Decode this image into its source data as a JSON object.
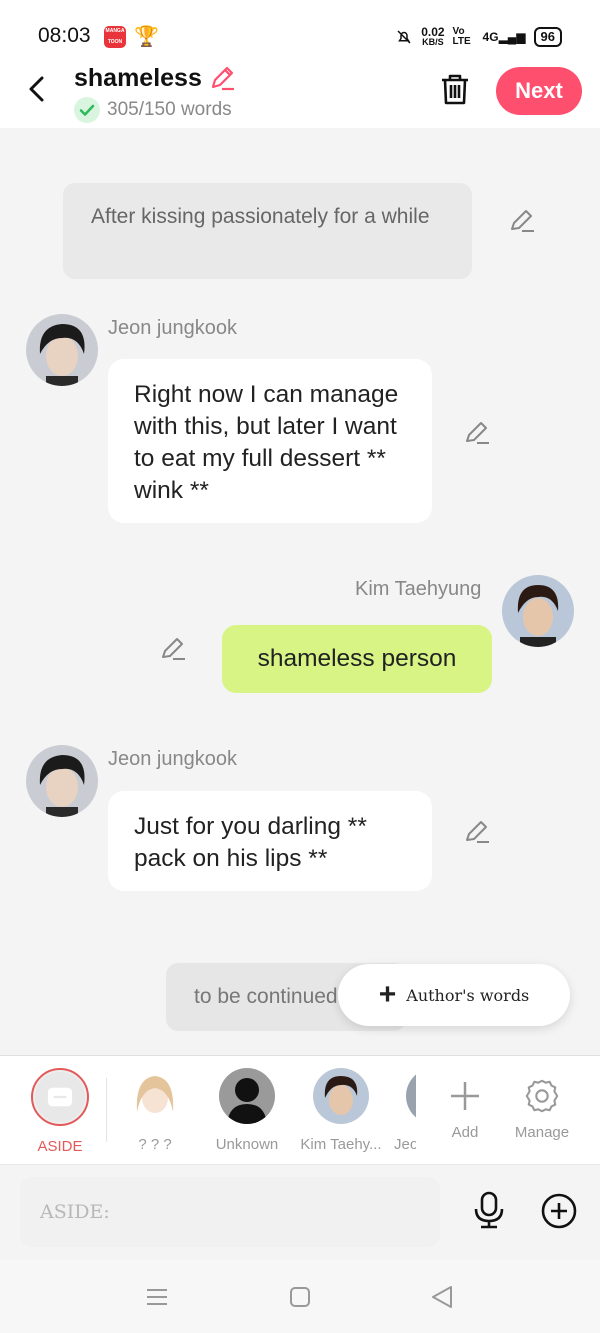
{
  "status_bar": {
    "time": "08:03",
    "app_badge_text": "MANGA TOON",
    "net_speed": "0.02",
    "net_unit": "KB/S",
    "volte": "Vo LTE",
    "signal": "4G",
    "battery": "96"
  },
  "header": {
    "title": "shameless",
    "word_count": "305/150 words",
    "next_label": "Next"
  },
  "messages": {
    "aside_text": "After kissing passionately for a while",
    "msg1": {
      "sender": "Jeon jungkook",
      "text": "Right now I can manage with this, but later I want to eat my full dessert ** wink **"
    },
    "msg2": {
      "sender": "Kim Taehyung",
      "text": "shameless person"
    },
    "msg3": {
      "sender": "Jeon jungkook",
      "text": "Just for you darling ** pack on his lips **"
    },
    "to_be_continued": "to be continued",
    "authors_words_label": "Author's words"
  },
  "characters": [
    {
      "label": "ASIDE"
    },
    {
      "label": "? ? ?"
    },
    {
      "label": "Unknown"
    },
    {
      "label": "Kim Taehy..."
    },
    {
      "label": "Jeo"
    },
    {
      "label": "Add"
    },
    {
      "label": "Manage"
    }
  ],
  "input": {
    "placeholder": "ASIDE:"
  },
  "colors": {
    "accent": "#ff4f6e",
    "green_bubble": "#d7f485",
    "aside_red": "#e35a5a"
  }
}
